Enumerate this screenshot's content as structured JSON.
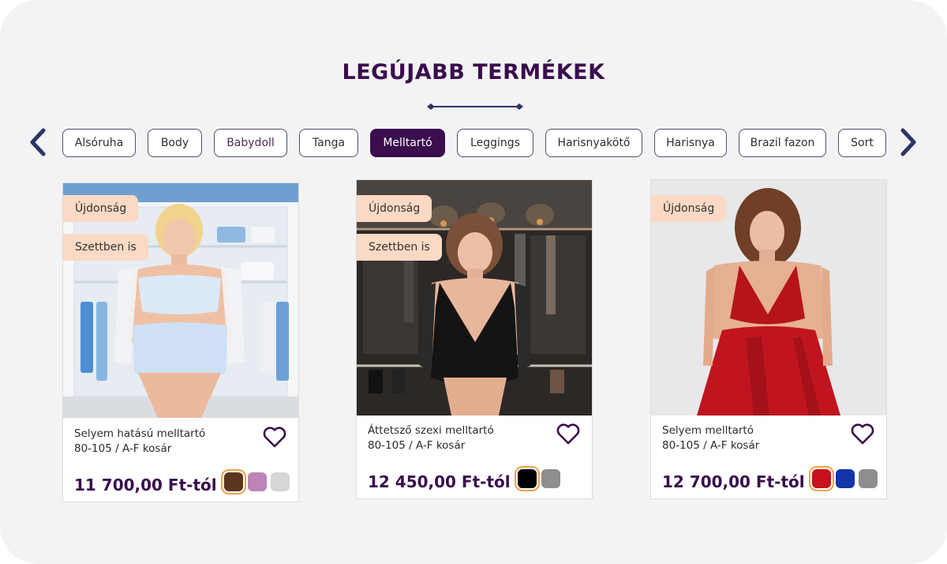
{
  "section": {
    "title": "LEGÚJABB TERMÉKEK"
  },
  "nav": {
    "prev_icon": "chevron-left-icon",
    "next_icon": "chevron-right-icon",
    "arrow_color": "#2c3566"
  },
  "categories": [
    {
      "label": "Alsóruha"
    },
    {
      "label": "Body"
    },
    {
      "label": "Babydoll"
    },
    {
      "label": "Tanga"
    },
    {
      "label": "Melltartó",
      "active": true
    },
    {
      "label": "Leggings"
    },
    {
      "label": "Harisnyakötő"
    },
    {
      "label": "Harisnya"
    },
    {
      "label": "Brazil fazon"
    },
    {
      "label": "Sort"
    }
  ],
  "products": [
    {
      "badges": [
        "Újdonság",
        "Szettben is"
      ],
      "name_line1": "Selyem hatású melltartó",
      "name_line2": "80-105 / A-F kosár",
      "price": "11 700,00 Ft-tól",
      "favorite_icon": "heart-outline-icon",
      "swatches": [
        {
          "color": "#5b3520",
          "selected": true
        },
        {
          "color": "#bd84b7"
        },
        {
          "color": "#d6d6d6"
        }
      ]
    },
    {
      "badges": [
        "Újdonság",
        "Szettben is"
      ],
      "name_line1": "Áttetsző szexi melltartó",
      "name_line2": "80-105 / A-F kosár",
      "price": "12 450,00 Ft-tól",
      "favorite_icon": "heart-outline-icon",
      "swatches": [
        {
          "color": "#000000",
          "selected": true
        },
        {
          "color": "#8e8e8e"
        }
      ]
    },
    {
      "badges": [
        "Újdonság"
      ],
      "name_line1": "Selyem melltartó",
      "name_line2": "80-105 / A-F kosár",
      "price": "12 700,00 Ft-tól",
      "favorite_icon": "heart-outline-icon",
      "swatches": [
        {
          "color": "#c8111c",
          "selected": true
        },
        {
          "color": "#1235a8"
        },
        {
          "color": "#8e8e8e"
        }
      ]
    }
  ],
  "colors": {
    "brand": "#3a0d4d",
    "badge_bg": "#fbd9c4",
    "selected_outline": "#f0a24b"
  }
}
